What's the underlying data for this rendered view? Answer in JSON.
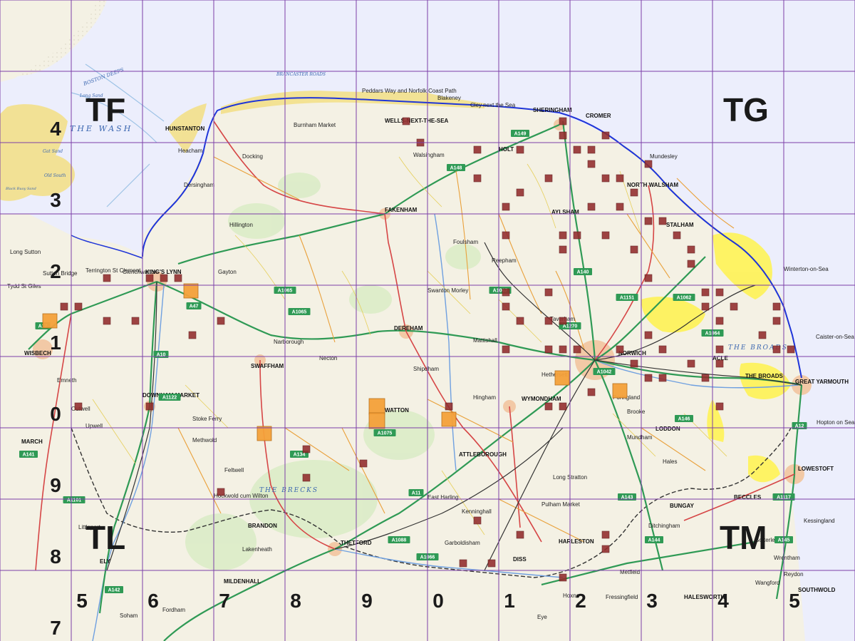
{
  "grid": {
    "squares": [
      "TF",
      "TG",
      "TL",
      "TM"
    ],
    "eastings": [
      "5",
      "6",
      "7",
      "8",
      "9",
      "0",
      "1",
      "2",
      "3",
      "4",
      "5"
    ],
    "northings": [
      "4",
      "3",
      "2",
      "1",
      "0",
      "9",
      "8",
      "7"
    ]
  },
  "sea_labels": {
    "wash": "THE WASH",
    "deeps": "BOSTON DEEPS",
    "sand_gat": "Gat Sand",
    "sand_long": "Long Sand",
    "sand_old_south": "Old South",
    "sand_black_buoy": "Black Buoy Sand",
    "roads": "BRANCASTER ROADS"
  },
  "areas": {
    "brecks": "THE BRECKS",
    "broads": "THE BROADS",
    "broads_small": "THE BROADS"
  },
  "towns": {
    "kings_lynn": "KING'S LYNN",
    "downham_market": "DOWNHAM MARKET",
    "swaffham": "SWAFFHAM",
    "thetford": "THETFORD",
    "diss": "DISS",
    "norwich": "NORWICH",
    "great_yarmouth": "GREAT YARMOUTH",
    "lowestoft": "LOWESTOFT",
    "cromer": "CROMER",
    "fakenham": "FAKENHAM",
    "dereham": "DEREHAM",
    "wymondham": "WYMONDHAM",
    "hunstanton": "HUNSTANTON",
    "sheringham": "SHERINGHAM",
    "aylsham": "AYLSHAM",
    "attleborough": "ATTLEBOROUGH",
    "wisbech": "WISBECH",
    "march": "MARCH",
    "ely": "ELY",
    "brandon": "BRANDON",
    "harleston": "HARLESTON",
    "bungay": "BUNGAY",
    "beccles": "BECCLES",
    "halesworth": "HALESWORTH",
    "southwold": "SOUTHWOLD",
    "mildenhall": "MILDENHALL",
    "watton": "WATTON",
    "north_walsham": "NORTH WALSHAM",
    "holt": "HOLT",
    "wells": "WELLS-NEXT-THE-SEA",
    "stalham": "STALHAM",
    "acle": "ACLE",
    "loddon": "LODDON",
    "feltwell": "Feltwell",
    "methwold": "Methwold",
    "lakenheath": "Lakenheath",
    "soham": "Soham",
    "fordham": "Fordham",
    "littleport": "Littleport",
    "kessingland": "Kessingland",
    "mundesley": "Mundesley",
    "caister": "Caister-on-Sea",
    "hopton": "Hopton on Sea",
    "winterton": "Winterton-on-Sea",
    "terrington": "Terrington St Clement",
    "clenchwarton": "Clenchwarton",
    "heacham": "Heacham",
    "dersingham": "Dersingham",
    "docking": "Docking",
    "burnham_market": "Burnham Market",
    "hillington": "Hillington",
    "gayton": "Gayton",
    "narborough": "Narborough",
    "necton": "Necton",
    "swanton_morley": "Swanton Morley",
    "reepham": "Reepham",
    "foulsham": "Foulsham",
    "taverham": "Taverham",
    "hethersett": "Hethersett",
    "long_stratton": "Long Stratton",
    "pulham": "Pulham Market",
    "brooke": "Brooke",
    "poringland": "Poringland",
    "hingham": "Hingham",
    "mattishall": "Mattishall",
    "shipdham": "Shipdham",
    "kenninghall": "Kenninghall",
    "garboldisham": "Garboldisham",
    "east_harling": "East Harling",
    "hockwold": "Hockwold cum Wilton",
    "stoke_ferry": "Stoke Ferry",
    "outwell": "Outwell",
    "upwell": "Upwell",
    "emneth": "Emneth",
    "tydd": "Tydd St Giles",
    "long_sutton": "Long Sutton",
    "sutton_bridge": "Sutton Bridge",
    "walsingham": "Walsingham",
    "blakeney": "Blakeney",
    "cley": "Cley next the Sea",
    "mundham": "Mundham",
    "hales": "Hales",
    "wrentham": "Wrentham",
    "reydon": "Reydon",
    "sotterley": "Sotterley",
    "ditchingham": "Ditchingham",
    "wangford": "Wangford",
    "hoxne": "Hoxne",
    "eye": "Eye",
    "fressingfield": "Fressingfield",
    "metfield": "Metfield"
  },
  "roads": {
    "a47": "A47",
    "a11": "A11",
    "a140": "A140",
    "a148": "A148",
    "a149": "A149",
    "a10": "A10",
    "a17": "A17",
    "a143": "A143",
    "a146": "A146",
    "a12": "A12",
    "a1066": "A1066",
    "a134": "A134",
    "a1065": "A1065",
    "a1067": "A1067",
    "a1075": "A1075",
    "a142": "A142",
    "a1122": "A1122",
    "a1101": "A1101",
    "a141": "A141",
    "a1151": "A1151",
    "a1062": "A1062",
    "a1042": "A1042",
    "a1270": "A1270",
    "a1117": "A1117",
    "a144": "A144",
    "a145": "A145",
    "a1088": "A1088",
    "a1064": "A1064",
    "a1065b": "A1065"
  },
  "coast_paths": {
    "peddars": "Peddars Way and Norfolk Coast Path"
  },
  "colors": {
    "sea": "#eceefc",
    "land": "#f4f1e4",
    "coast": "#1f35d8",
    "grid": "#7c3fa8",
    "sand": "#f3e08a",
    "woodland": "#d9ecc6",
    "broads": "#fff34d",
    "urban": "#f2c9a6",
    "marker_red": "#922c2c",
    "marker_orange": "#f5a13a",
    "road_green": "#2f9a55",
    "road_red": "#d64646",
    "road_orange": "#e9a03a"
  }
}
